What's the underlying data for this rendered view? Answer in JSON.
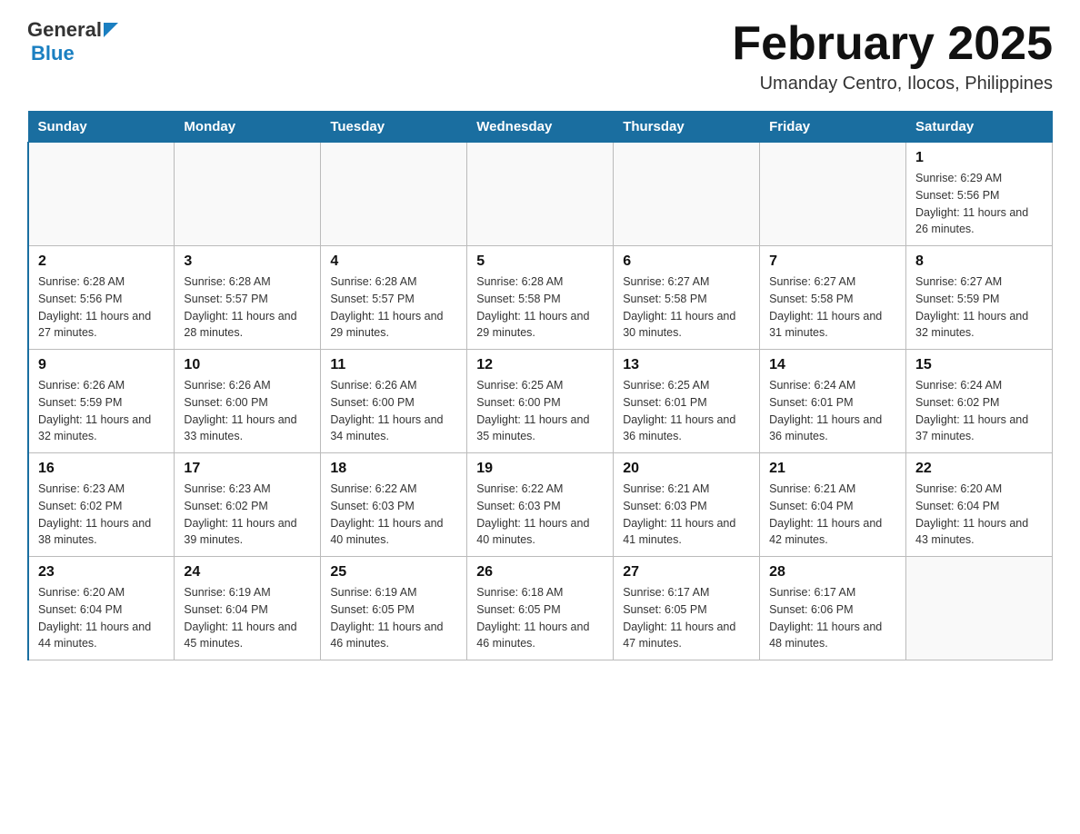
{
  "logo": {
    "general": "General",
    "blue": "Blue"
  },
  "header": {
    "title": "February 2025",
    "subtitle": "Umanday Centro, Ilocos, Philippines"
  },
  "weekdays": [
    "Sunday",
    "Monday",
    "Tuesday",
    "Wednesday",
    "Thursday",
    "Friday",
    "Saturday"
  ],
  "weeks": [
    [
      {
        "day": "",
        "info": ""
      },
      {
        "day": "",
        "info": ""
      },
      {
        "day": "",
        "info": ""
      },
      {
        "day": "",
        "info": ""
      },
      {
        "day": "",
        "info": ""
      },
      {
        "day": "",
        "info": ""
      },
      {
        "day": "1",
        "info": "Sunrise: 6:29 AM\nSunset: 5:56 PM\nDaylight: 11 hours and 26 minutes."
      }
    ],
    [
      {
        "day": "2",
        "info": "Sunrise: 6:28 AM\nSunset: 5:56 PM\nDaylight: 11 hours and 27 minutes."
      },
      {
        "day": "3",
        "info": "Sunrise: 6:28 AM\nSunset: 5:57 PM\nDaylight: 11 hours and 28 minutes."
      },
      {
        "day": "4",
        "info": "Sunrise: 6:28 AM\nSunset: 5:57 PM\nDaylight: 11 hours and 29 minutes."
      },
      {
        "day": "5",
        "info": "Sunrise: 6:28 AM\nSunset: 5:58 PM\nDaylight: 11 hours and 29 minutes."
      },
      {
        "day": "6",
        "info": "Sunrise: 6:27 AM\nSunset: 5:58 PM\nDaylight: 11 hours and 30 minutes."
      },
      {
        "day": "7",
        "info": "Sunrise: 6:27 AM\nSunset: 5:58 PM\nDaylight: 11 hours and 31 minutes."
      },
      {
        "day": "8",
        "info": "Sunrise: 6:27 AM\nSunset: 5:59 PM\nDaylight: 11 hours and 32 minutes."
      }
    ],
    [
      {
        "day": "9",
        "info": "Sunrise: 6:26 AM\nSunset: 5:59 PM\nDaylight: 11 hours and 32 minutes."
      },
      {
        "day": "10",
        "info": "Sunrise: 6:26 AM\nSunset: 6:00 PM\nDaylight: 11 hours and 33 minutes."
      },
      {
        "day": "11",
        "info": "Sunrise: 6:26 AM\nSunset: 6:00 PM\nDaylight: 11 hours and 34 minutes."
      },
      {
        "day": "12",
        "info": "Sunrise: 6:25 AM\nSunset: 6:00 PM\nDaylight: 11 hours and 35 minutes."
      },
      {
        "day": "13",
        "info": "Sunrise: 6:25 AM\nSunset: 6:01 PM\nDaylight: 11 hours and 36 minutes."
      },
      {
        "day": "14",
        "info": "Sunrise: 6:24 AM\nSunset: 6:01 PM\nDaylight: 11 hours and 36 minutes."
      },
      {
        "day": "15",
        "info": "Sunrise: 6:24 AM\nSunset: 6:02 PM\nDaylight: 11 hours and 37 minutes."
      }
    ],
    [
      {
        "day": "16",
        "info": "Sunrise: 6:23 AM\nSunset: 6:02 PM\nDaylight: 11 hours and 38 minutes."
      },
      {
        "day": "17",
        "info": "Sunrise: 6:23 AM\nSunset: 6:02 PM\nDaylight: 11 hours and 39 minutes."
      },
      {
        "day": "18",
        "info": "Sunrise: 6:22 AM\nSunset: 6:03 PM\nDaylight: 11 hours and 40 minutes."
      },
      {
        "day": "19",
        "info": "Sunrise: 6:22 AM\nSunset: 6:03 PM\nDaylight: 11 hours and 40 minutes."
      },
      {
        "day": "20",
        "info": "Sunrise: 6:21 AM\nSunset: 6:03 PM\nDaylight: 11 hours and 41 minutes."
      },
      {
        "day": "21",
        "info": "Sunrise: 6:21 AM\nSunset: 6:04 PM\nDaylight: 11 hours and 42 minutes."
      },
      {
        "day": "22",
        "info": "Sunrise: 6:20 AM\nSunset: 6:04 PM\nDaylight: 11 hours and 43 minutes."
      }
    ],
    [
      {
        "day": "23",
        "info": "Sunrise: 6:20 AM\nSunset: 6:04 PM\nDaylight: 11 hours and 44 minutes."
      },
      {
        "day": "24",
        "info": "Sunrise: 6:19 AM\nSunset: 6:04 PM\nDaylight: 11 hours and 45 minutes."
      },
      {
        "day": "25",
        "info": "Sunrise: 6:19 AM\nSunset: 6:05 PM\nDaylight: 11 hours and 46 minutes."
      },
      {
        "day": "26",
        "info": "Sunrise: 6:18 AM\nSunset: 6:05 PM\nDaylight: 11 hours and 46 minutes."
      },
      {
        "day": "27",
        "info": "Sunrise: 6:17 AM\nSunset: 6:05 PM\nDaylight: 11 hours and 47 minutes."
      },
      {
        "day": "28",
        "info": "Sunrise: 6:17 AM\nSunset: 6:06 PM\nDaylight: 11 hours and 48 minutes."
      },
      {
        "day": "",
        "info": ""
      }
    ]
  ]
}
